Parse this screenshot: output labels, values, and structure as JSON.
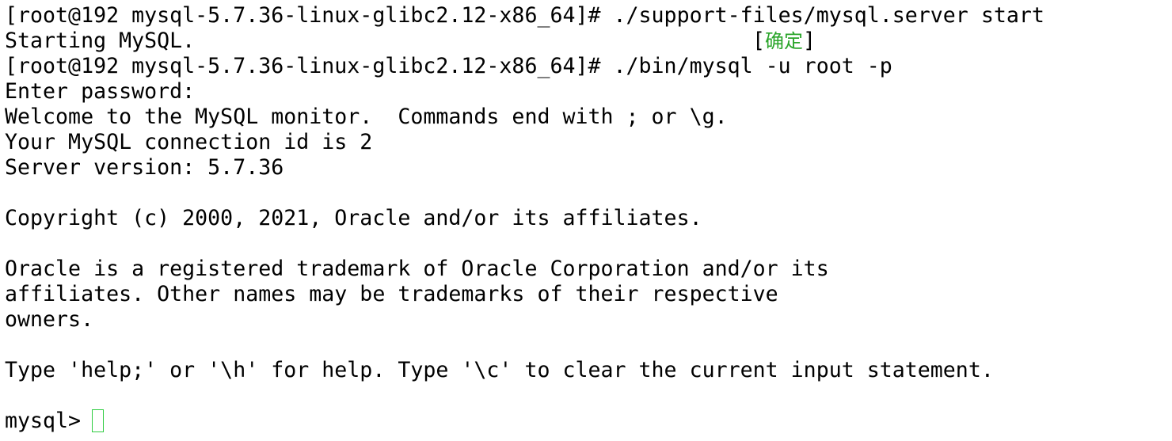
{
  "terminal": {
    "lines": {
      "cmd_start": "[root@192 mysql-5.7.36-linux-glibc2.12-x86_64]# ./support-files/mysql.server start",
      "starting": "Starting MySQL.",
      "cmd_login": "[root@192 mysql-5.7.36-linux-glibc2.12-x86_64]# ./bin/mysql -u root -p",
      "enter_password": "Enter password:",
      "welcome": "Welcome to the MySQL monitor.  Commands end with ; or \\g.",
      "connection_id": "Your MySQL connection id is 2",
      "server_version": "Server version: 5.7.36",
      "copyright": "Copyright (c) 2000, 2021, Oracle and/or its affiliates.",
      "trademark_1": "Oracle is a registered trademark of Oracle Corporation and/or its",
      "trademark_2": "affiliates. Other names may be trademarks of their respective",
      "trademark_3": "owners.",
      "help_hint": "Type 'help;' or '\\h' for help. Type '\\c' to clear the current input statement.",
      "prompt": "mysql> "
    },
    "status": {
      "open_bracket": "[",
      "ok_text": "确定",
      "close_bracket": "]"
    },
    "colors": {
      "background": "#ffffff",
      "text": "#000000",
      "ok_green": "#2aa52a",
      "cursor_green": "#2ecc40"
    }
  }
}
